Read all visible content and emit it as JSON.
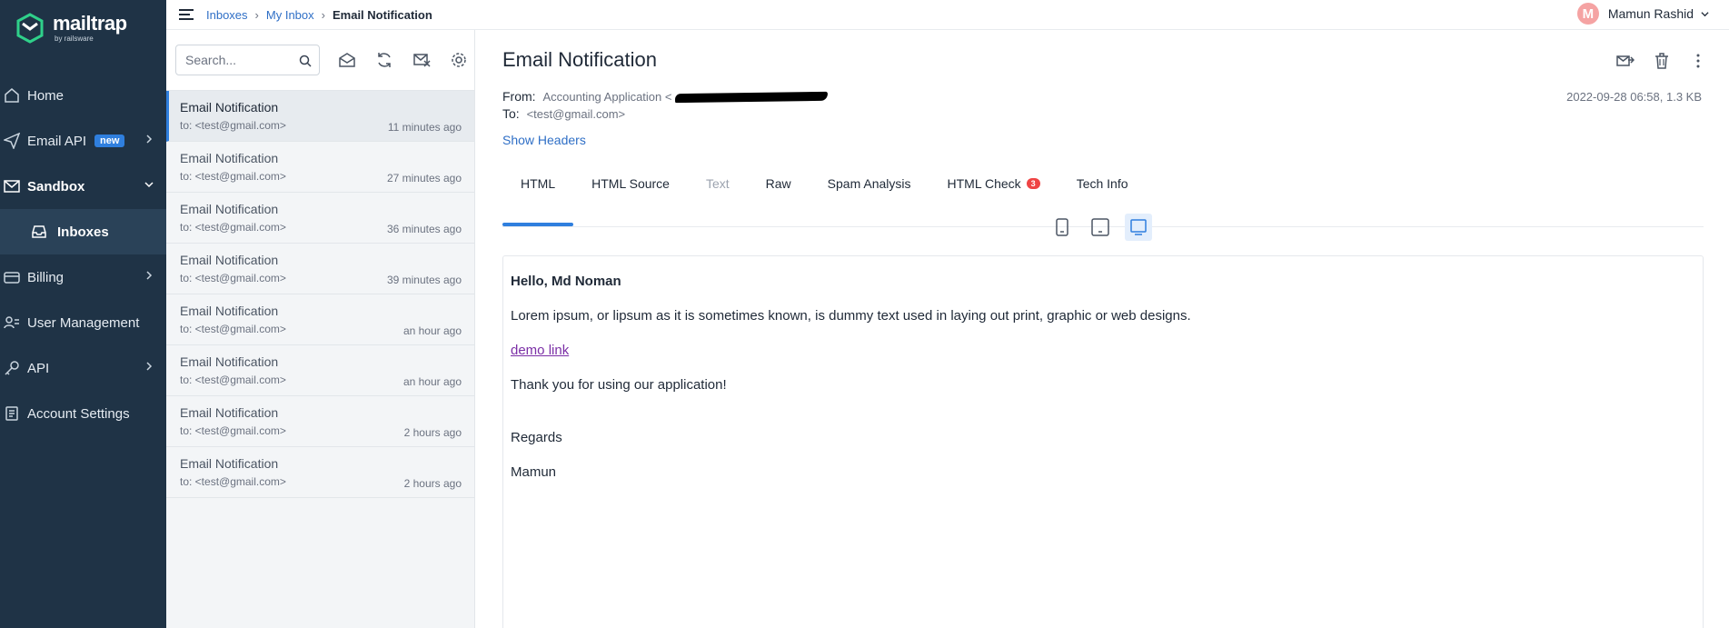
{
  "app": {
    "logo_name": "mailtrap",
    "logo_sub": "by railsware"
  },
  "colors": {
    "sidebar_bg": "#1f3346",
    "accent": "#2f7fde",
    "link": "#2f6fc6",
    "badge_red": "#ef4444"
  },
  "sidebar": {
    "items": [
      {
        "label": "Home",
        "icon": "home-icon"
      },
      {
        "label": "Email API",
        "icon": "send-icon",
        "badge": "new"
      },
      {
        "label": "Sandbox",
        "icon": "sandbox-icon"
      },
      {
        "label": "Inboxes",
        "icon": "inbox-icon"
      },
      {
        "label": "Billing",
        "icon": "billing-icon"
      },
      {
        "label": "User Management",
        "icon": "users-icon"
      },
      {
        "label": "API",
        "icon": "key-icon"
      },
      {
        "label": "Account Settings",
        "icon": "settings-doc-icon"
      }
    ]
  },
  "breadcrumb": {
    "items": [
      "Inboxes",
      "My Inbox"
    ],
    "current": "Email Notification"
  },
  "user": {
    "initial": "M",
    "name": "Mamun Rashid"
  },
  "list": {
    "search_placeholder": "Search...",
    "messages": [
      {
        "subject": "Email Notification",
        "to": "to: <test@gmail.com>",
        "time": "11 minutes ago"
      },
      {
        "subject": "Email Notification",
        "to": "to: <test@gmail.com>",
        "time": "27 minutes ago"
      },
      {
        "subject": "Email Notification",
        "to": "to: <test@gmail.com>",
        "time": "36 minutes ago"
      },
      {
        "subject": "Email Notification",
        "to": "to: <test@gmail.com>",
        "time": "39 minutes ago"
      },
      {
        "subject": "Email Notification",
        "to": "to: <test@gmail.com>",
        "time": "an hour ago"
      },
      {
        "subject": "Email Notification",
        "to": "to: <test@gmail.com>",
        "time": "an hour ago"
      },
      {
        "subject": "Email Notification",
        "to": "to: <test@gmail.com>",
        "time": "2 hours ago"
      },
      {
        "subject": "Email Notification",
        "to": "to: <test@gmail.com>",
        "time": "2 hours ago"
      }
    ]
  },
  "email": {
    "title": "Email Notification",
    "from_label": "From:",
    "from_value": "Accounting Application <",
    "to_label": "To:",
    "to_value": "<test@gmail.com>",
    "date_size": "2022-09-28 06:58, 1.3 KB",
    "show_headers": "Show Headers",
    "tabs": [
      "HTML",
      "HTML Source",
      "Text",
      "Raw",
      "Spam Analysis",
      "HTML Check",
      "Tech Info"
    ],
    "html_check_count": "3",
    "body": {
      "greeting": "Hello, Md Noman",
      "paragraph": "Lorem ipsum, or lipsum as it is sometimes known, is dummy text used in laying out print, graphic or web designs.",
      "link": "demo link",
      "thanks": "Thank you for using our application!",
      "regards": "Regards",
      "signature": "Mamun"
    }
  }
}
